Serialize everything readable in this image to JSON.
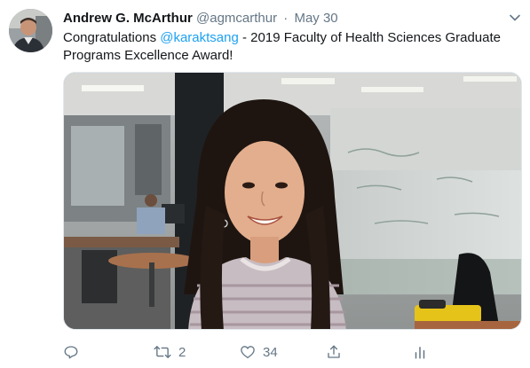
{
  "author": {
    "display_name": "Andrew G. McArthur",
    "handle": "@agmcarthur",
    "separator": "·",
    "timestamp": "May 30"
  },
  "tweet": {
    "text_before": "Congratulations ",
    "mention": "@karaktsang",
    "text_after": " - 2019 Faculty of Health Sciences Graduate Programs Excellence Award!"
  },
  "actions": {
    "reply_count": "",
    "retweet_count": "2",
    "like_count": "34"
  },
  "icons": [
    "chevron-down-icon",
    "reply-icon",
    "retweet-icon",
    "like-icon",
    "share-icon",
    "analytics-icon"
  ],
  "colors": {
    "link": "#1da1f2",
    "muted": "#657786",
    "text": "#14171a"
  }
}
